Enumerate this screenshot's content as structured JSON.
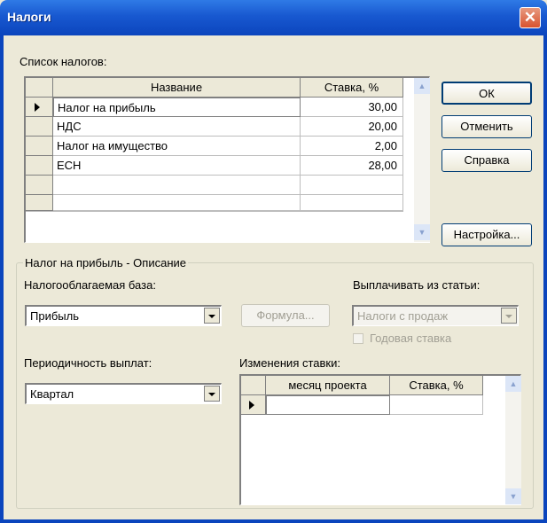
{
  "window": {
    "title": "Налоги",
    "close_glyph": "✕"
  },
  "tax_list": {
    "label": "Список налогов:",
    "columns": [
      "Название",
      "Ставка, %"
    ],
    "rows": [
      {
        "name": "Налог на прибыль",
        "rate": "30,00",
        "selected": true
      },
      {
        "name": "НДС",
        "rate": "20,00"
      },
      {
        "name": "Налог на имущество",
        "rate": "2,00"
      },
      {
        "name": "ЕСН",
        "rate": "28,00"
      }
    ]
  },
  "buttons": {
    "ok": "ОК",
    "cancel": "Отменить",
    "help": "Справка",
    "settings": "Настройка..."
  },
  "description": {
    "title": "Налог на прибыль - Описание",
    "taxable_base_label": "Налогооблагаемая база:",
    "taxable_base_value": "Прибыль",
    "formula_button": "Формула...",
    "pay_from_label": "Выплачивать из статьи:",
    "pay_from_value": "Налоги с продаж",
    "annual_rate_label": "Годовая ставка",
    "annual_rate_checked": false,
    "periodicity_label": "Периодичность выплат:",
    "periodicity_value": "Квартал",
    "rate_changes_label": "Изменения ставки:",
    "rate_changes_columns": [
      "месяц проекта",
      "Ставка, %"
    ]
  },
  "icons": {
    "row_indicator": "triangle-right-icon",
    "scroll_up": "chevron-up-icon",
    "scroll_down": "chevron-down-icon",
    "dropdown": "chevron-down-icon"
  }
}
